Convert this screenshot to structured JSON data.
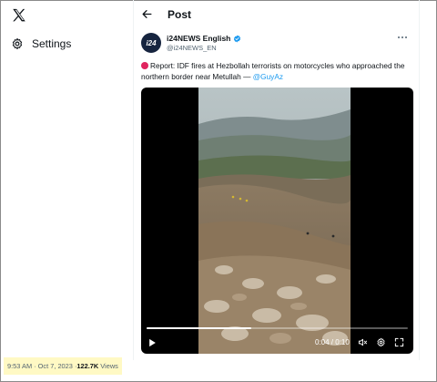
{
  "nav": {
    "logo_icon": "x-logo-icon",
    "settings_label": "Settings",
    "settings_icon": "gear-icon"
  },
  "header": {
    "back_icon": "back-arrow-icon",
    "title": "Post"
  },
  "post": {
    "avatar_text": "i24",
    "author_name": "i24NEWS English",
    "verified_color": "#1d9bf0",
    "handle": "@i24NEWS_EN",
    "text_body": "Report: IDF fires at Hezbollah terrorists on motorcycles who approached the northern border near Metullah — ",
    "mention": "@GuyAz",
    "video": {
      "progress": 0.4,
      "time": "0:04 / 0:10"
    },
    "timestamp": "9:53 AM · Oct 7, 2023 · ",
    "views_count": "122.7K",
    "views_label": "Views"
  },
  "colors": {
    "accent": "#1d9bf0",
    "highlight": "#fff9c4"
  }
}
